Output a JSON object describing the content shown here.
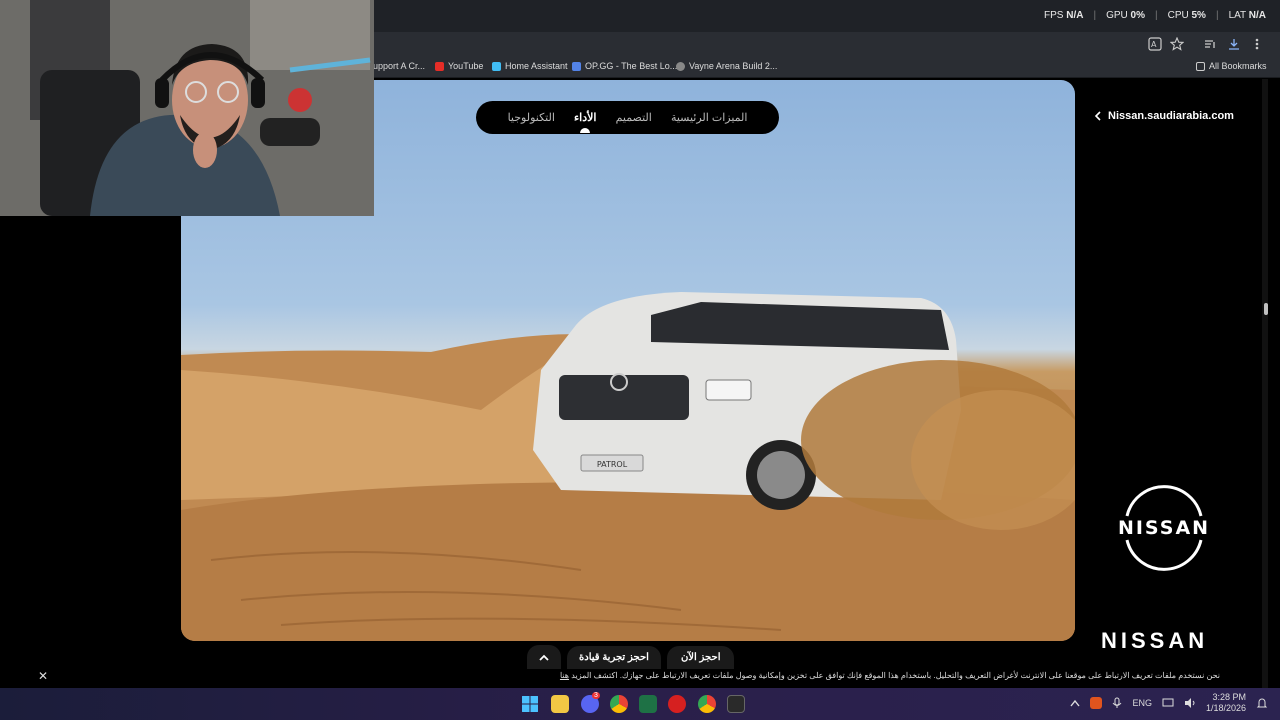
{
  "overlay": {
    "fps_label": "FPS",
    "fps_value": "N/A",
    "gpu_label": "GPU",
    "gpu_value": "0%",
    "cpu_label": "CPU",
    "cpu_value": "5%",
    "lat_label": "LAT",
    "lat_value": "N/A"
  },
  "bookmarks": {
    "items": [
      "upport A Cr...",
      "YouTube",
      "Home Assistant",
      "OP.GG - The Best Lo...",
      "Vayne Arena Build 2..."
    ],
    "all": "All Bookmarks"
  },
  "nav": {
    "items": [
      "الميزات الرئيسية",
      "التصميم",
      "الأداء",
      "التكنولوجيا"
    ],
    "active_index": 2
  },
  "site_link": "Nissan.saudiarabia.com",
  "brand": {
    "logo_text": "NISSAN",
    "wordmark": "NISSAN"
  },
  "actions": {
    "book_now": "احجز الآن",
    "test_drive": "احجز تجربة قيادة"
  },
  "cookie": {
    "text": "نحن نستخدم ملفات تعريف الارتباط على موقعنا على الانترنت لأغراض التعريف والتحليل. باستخدام هذا الموقع فإنك توافق على تخزين وإمكانية وصول ملفات تعريف الارتباط على جهازك. اكتشف المزيد",
    "link": "هنا"
  },
  "hero": {
    "plate": "PATROL"
  },
  "taskbar": {
    "lang": "ENG",
    "time": "3:28 PM",
    "date": "1/18/2026",
    "discord_badge": "3"
  },
  "colors": {
    "sky": "#a9c6e3",
    "sand": "#b78650",
    "nav_bg": "#000000"
  }
}
